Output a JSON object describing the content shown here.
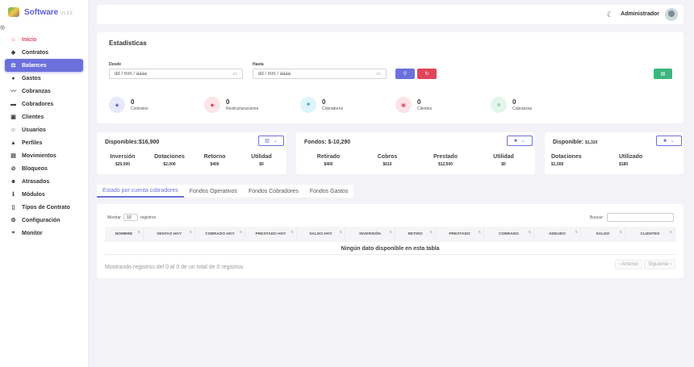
{
  "app": {
    "name": "Software",
    "version": "V1.0.6"
  },
  "sidebar": {
    "items": [
      {
        "label": "Inicio",
        "icon": "home-icon"
      },
      {
        "label": "Contratos",
        "icon": "handshake-icon"
      },
      {
        "label": "Balances",
        "icon": "scale-icon"
      },
      {
        "label": "Gastos",
        "icon": "coins-icon"
      },
      {
        "label": "Cobranzas",
        "icon": "chart-line-icon"
      },
      {
        "label": "Cobradores",
        "icon": "briefcase-icon"
      },
      {
        "label": "Clientes",
        "icon": "id-card-icon"
      },
      {
        "label": "Usuarios",
        "icon": "users-icon"
      },
      {
        "label": "Perfiles",
        "icon": "lock-icon"
      },
      {
        "label": "Movimientos",
        "icon": "list-icon"
      },
      {
        "label": "Bloqueos",
        "icon": "ban-icon"
      },
      {
        "label": "Atrasados",
        "icon": "people-icon"
      },
      {
        "label": "Módulos",
        "icon": "info-icon"
      },
      {
        "label": "Tipos de Contrato",
        "icon": "document-icon"
      },
      {
        "label": "Configuración",
        "icon": "settings-icon"
      },
      {
        "label": "Monitor",
        "icon": "map-pin-icon"
      }
    ]
  },
  "topbar": {
    "user": "Administrador"
  },
  "stats": {
    "title": "Estadísticas",
    "desde_label": "Desde",
    "hasta_label": "Hasta",
    "date_placeholder": "dd / mm / aaaa",
    "items": [
      {
        "value": "0",
        "label": "Contratos"
      },
      {
        "value": "0",
        "label": "Restructuraciones"
      },
      {
        "value": "0",
        "label": "Cobradores"
      },
      {
        "value": "0",
        "label": "Clientes"
      },
      {
        "value": "0",
        "label": "Cobranzas"
      }
    ]
  },
  "summary": {
    "card1": {
      "title": "Disponibles:$16,900",
      "metrics": [
        {
          "label": "Inversión",
          "value": "$20,000"
        },
        {
          "label": "Dotaciones",
          "value": "$2,000"
        },
        {
          "label": "Retorno",
          "value": "$400"
        },
        {
          "label": "Utilidad",
          "value": "$0"
        }
      ]
    },
    "card2": {
      "title": "Fondos: $-10,290",
      "metrics": [
        {
          "label": "Retirado",
          "value": "$400"
        },
        {
          "label": "Cobros",
          "value": "$610"
        },
        {
          "label": "Prestado",
          "value": "$12,500"
        },
        {
          "label": "Utilidad",
          "value": "$0"
        }
      ]
    },
    "card3": {
      "title": "Disponible:",
      "title_value": "$1,320",
      "metrics": [
        {
          "label": "Dotaciones",
          "value": "$1,500"
        },
        {
          "label": "Utilizado",
          "value": "$180"
        }
      ]
    }
  },
  "tabs": [
    "Estado por cuenta cobradores",
    "Fondos Operativos",
    "Fondos Cobradores",
    "Fondos Gastos"
  ],
  "table": {
    "show_label": "Mostrar",
    "show_value": "10",
    "records_label": "registros",
    "search_label": "Buscar:",
    "columns": [
      "NOMBRE",
      "VENTAS HOY",
      "COBRADO HOY",
      "PRESTADO HOY",
      "SALDO HOY",
      "INVERSIÓN",
      "RETIRO",
      "PRESTADO",
      "COBRADO",
      "ADEUDO",
      "SALDO",
      "CLIENTES"
    ],
    "empty_message": "Ningún dato disponible en esta tabla",
    "info": "Mostrando registros del 0 al 0 de un total de 0 registros",
    "prev": "‹ Anterior",
    "next": "Siguiente ›"
  },
  "colors": {
    "accent": "#6c70dc",
    "danger": "#e0455b",
    "success": "#3bb77e"
  }
}
